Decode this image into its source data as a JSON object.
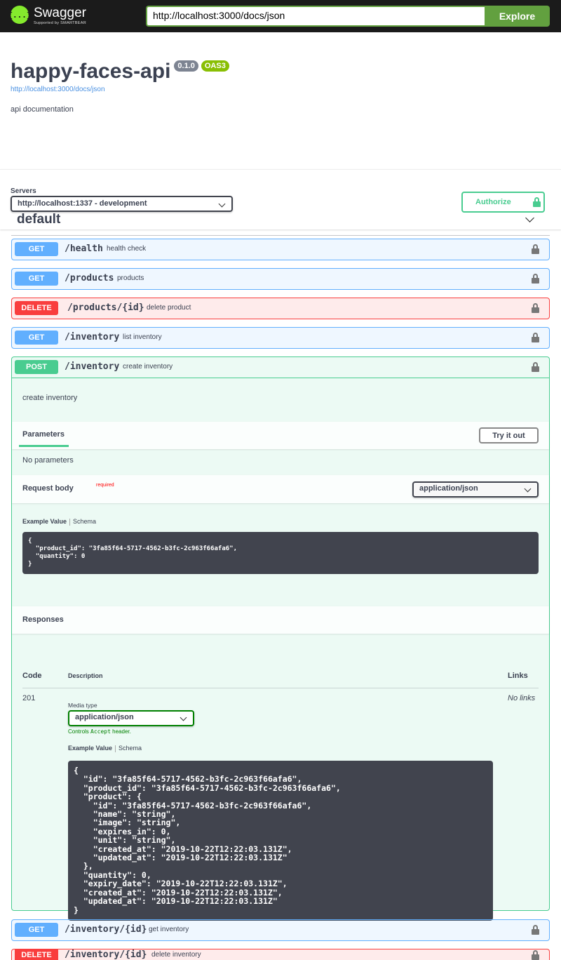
{
  "topbar": {
    "logo_symbol": "{...}",
    "logo_name": "Swagger",
    "logo_sub": "Supported by SMARTBEAR",
    "url_value": "http://localhost:3000/docs/json",
    "explore_label": "Explore"
  },
  "info": {
    "title": "happy-faces-api",
    "version": "0.1.0",
    "oas": "OAS3",
    "link": "http://localhost:3000/docs/json",
    "description": "api documentation"
  },
  "servers": {
    "label": "Servers",
    "selected": "http://localhost:1337 - development",
    "authorize_label": "Authorize"
  },
  "tag": {
    "name": "default"
  },
  "operations": [
    {
      "method": "GET",
      "path": "/health",
      "summary": "health check"
    },
    {
      "method": "GET",
      "path": "/products",
      "summary": "products"
    },
    {
      "method": "DELETE",
      "path": "/products/{id}",
      "summary": "delete product"
    },
    {
      "method": "GET",
      "path": "/inventory",
      "summary": "list inventory"
    },
    {
      "method": "POST",
      "path": "/inventory",
      "summary": "create inventory"
    },
    {
      "method": "GET",
      "path": "/inventory/{id}",
      "summary": "get inventory"
    },
    {
      "method": "DELETE",
      "path": "/inventory/{id}",
      "summary": "delete inventory"
    }
  ],
  "post_detail": {
    "description": "create inventory",
    "parameters_title": "Parameters",
    "try_it_out": "Try it out",
    "no_parameters": "No parameters",
    "request_body_label": "Request body",
    "required": "required",
    "request_content_type": "application/json",
    "example_value_tab": "Example Value",
    "schema_tab": "Schema",
    "request_example": "{\n  \"product_id\": \"3fa85f64-5717-4562-b3fc-2c963f66afa6\",\n  \"quantity\": 0\n}",
    "responses_title": "Responses",
    "col_code": "Code",
    "col_description": "Description",
    "col_links": "Links",
    "response_code": "201",
    "media_type_label": "Media type",
    "response_content_type": "application/json",
    "controls_prefix": "Controls ",
    "controls_code": "Accept",
    "controls_suffix": " header.",
    "no_links": "No links",
    "response_example": "{\n  \"id\": \"3fa85f64-5717-4562-b3fc-2c963f66afa6\",\n  \"product_id\": \"3fa85f64-5717-4562-b3fc-2c963f66afa6\",\n  \"product\": {\n    \"id\": \"3fa85f64-5717-4562-b3fc-2c963f66afa6\",\n    \"name\": \"string\",\n    \"image\": \"string\",\n    \"expires_in\": 0,\n    \"unit\": \"string\",\n    \"created_at\": \"2019-10-22T12:22:03.131Z\",\n    \"updated_at\": \"2019-10-22T12:22:03.131Z\"\n  },\n  \"quantity\": 0,\n  \"expiry_date\": \"2019-10-22T12:22:03.131Z\",\n  \"created_at\": \"2019-10-22T12:22:03.131Z\",\n  \"updated_at\": \"2019-10-22T12:22:03.131Z\"\n}"
  },
  "colors": {
    "get": "#61affe",
    "post": "#49cc90",
    "delete": "#f93e3e",
    "topbar": "#1b1b1b",
    "explore": "#62a03f"
  }
}
